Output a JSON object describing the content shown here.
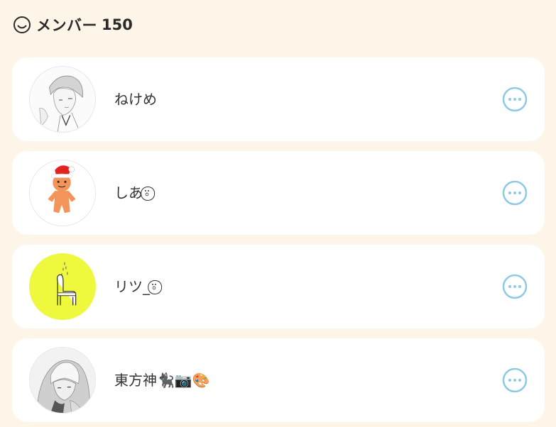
{
  "header": {
    "icon": "smile-face-icon",
    "title": "メンバー",
    "count": "150"
  },
  "members": [
    {
      "name": "ねけめ",
      "avatar": "sketch-portrait-avatar"
    },
    {
      "name": "しあ⍤⃝",
      "avatar": "gingerbread-santa-avatar"
    },
    {
      "name": "リツ_⍤⃝",
      "avatar": "llama-doodle-avatar"
    },
    {
      "name": "東方神🐈‍⬛📷🎨",
      "avatar": "anime-character-avatar"
    }
  ],
  "more_icon": "more-options-icon",
  "colors": {
    "background": "#fdf5e8",
    "card": "#ffffff",
    "accent": "#8ecbe3",
    "text": "#333333"
  }
}
